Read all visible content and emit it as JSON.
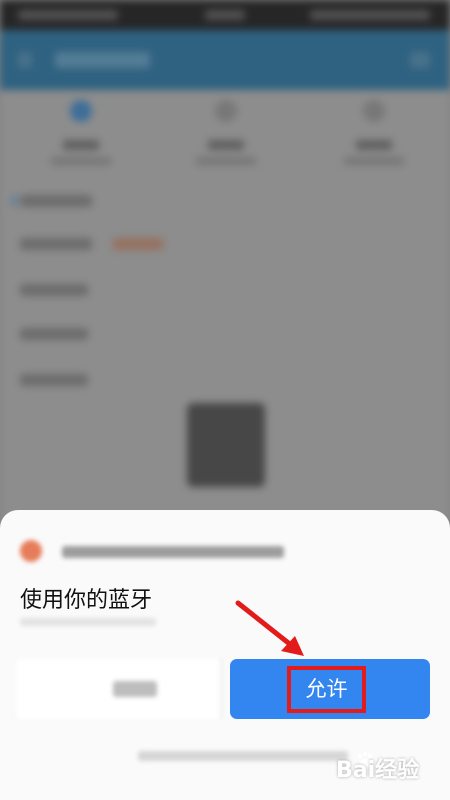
{
  "dialog": {
    "title": "使用你的蓝牙",
    "allow_label": "允许"
  },
  "watermark": {
    "text": "Bai经验"
  },
  "colors": {
    "allow_button": "#3385f0",
    "highlight_box": "#e21b1b",
    "arrow": "#e21b1b",
    "header": "#2b6f98"
  },
  "icons": {
    "arrow": "red-annotation-arrow",
    "watermark_logo": "baidu-paw-icon"
  }
}
